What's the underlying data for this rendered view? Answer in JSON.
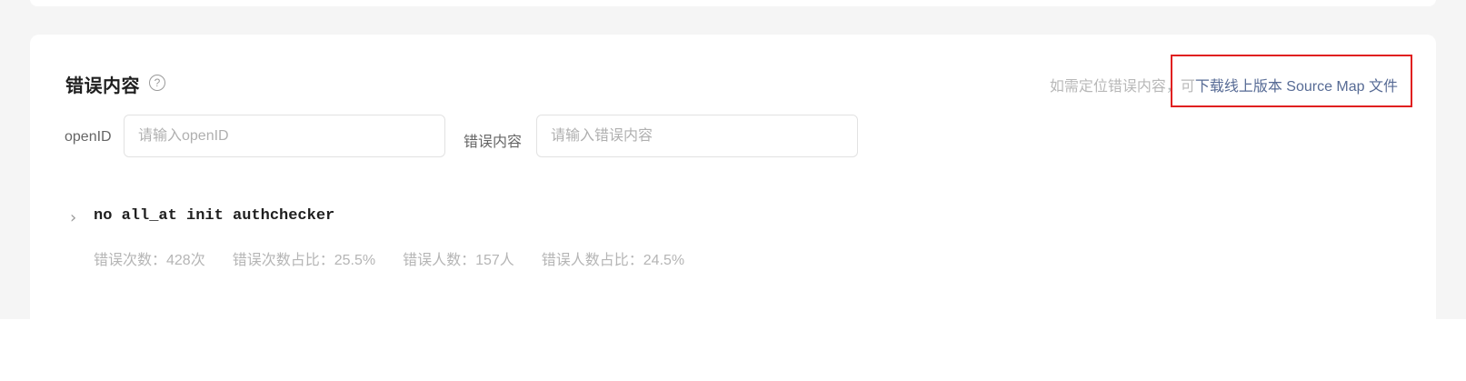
{
  "section": {
    "title": "错误内容",
    "help_icon_glyph": "?"
  },
  "hint": {
    "prefix": "如需定位错误内容，可",
    "link_text": "下载线上版本 Source Map 文件"
  },
  "filters": {
    "openid_label": "openID",
    "openid_placeholder": "请输入openID",
    "openid_value": "",
    "content_label": "错误内容",
    "content_placeholder": "请输入错误内容",
    "content_value": ""
  },
  "error_item": {
    "expand_glyph": "›",
    "message": "no all_at init authchecker",
    "stats": {
      "count": "错误次数：428次",
      "count_ratio": "错误次数占比：25.5%",
      "users": "错误人数：157人",
      "users_ratio": "错误人数占比：24.5%"
    }
  },
  "colors": {
    "link": "#576b95",
    "highlight": "#e02020",
    "page_bg": "#f5f5f5"
  }
}
